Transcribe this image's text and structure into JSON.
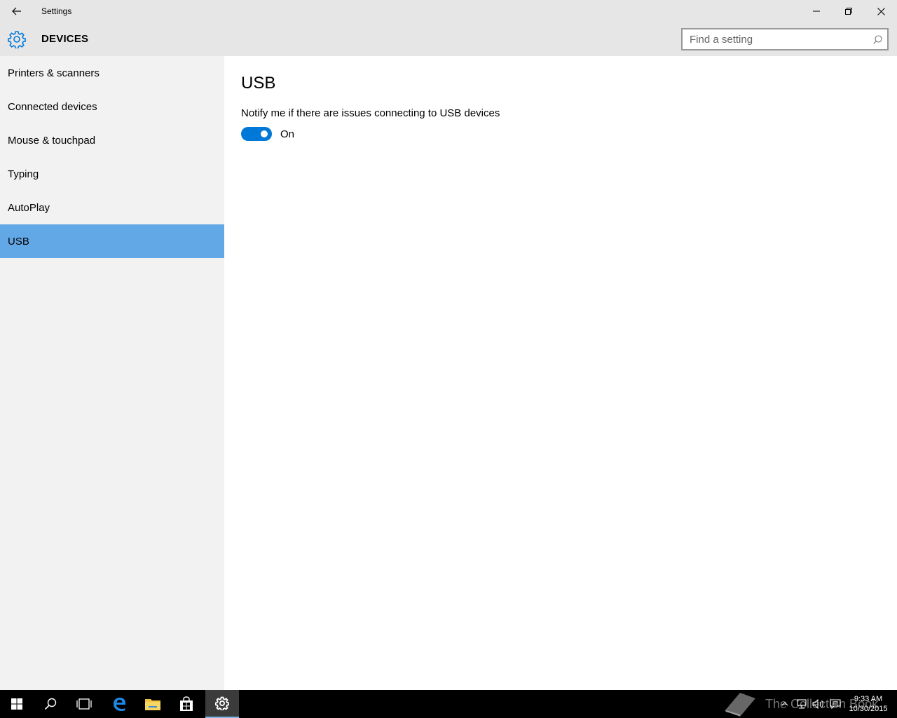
{
  "window": {
    "title": "Settings",
    "back_icon": "back-arrow-icon",
    "minimize_icon": "minimize-icon",
    "restore_icon": "restore-icon",
    "close_icon": "close-icon"
  },
  "header": {
    "icon": "gear-icon",
    "title": "DEVICES",
    "search": {
      "placeholder": "Find a setting",
      "value": "",
      "icon": "search-icon"
    }
  },
  "sidebar": {
    "items": [
      {
        "label": "Printers & scanners",
        "selected": false
      },
      {
        "label": "Connected devices",
        "selected": false
      },
      {
        "label": "Mouse & touchpad",
        "selected": false
      },
      {
        "label": "Typing",
        "selected": false
      },
      {
        "label": "AutoPlay",
        "selected": false
      },
      {
        "label": "USB",
        "selected": true
      }
    ]
  },
  "main": {
    "title": "USB",
    "setting_label": "Notify me if there are issues connecting to USB devices",
    "toggle": {
      "state": "On",
      "on": true
    }
  },
  "taskbar": {
    "items": [
      "start-icon",
      "search-icon",
      "task-view-icon",
      "edge-icon",
      "file-explorer-icon",
      "store-icon",
      "settings-icon"
    ],
    "active": "settings-icon",
    "watermark": "The Collection Book",
    "clock": {
      "time": "9:33 AM",
      "date": "10/30/2015"
    }
  },
  "colors": {
    "accent": "#0078d7",
    "selected_nav": "#63a8e6",
    "chrome": "#e6e6e6",
    "sidebar_bg": "#f2f2f2"
  }
}
